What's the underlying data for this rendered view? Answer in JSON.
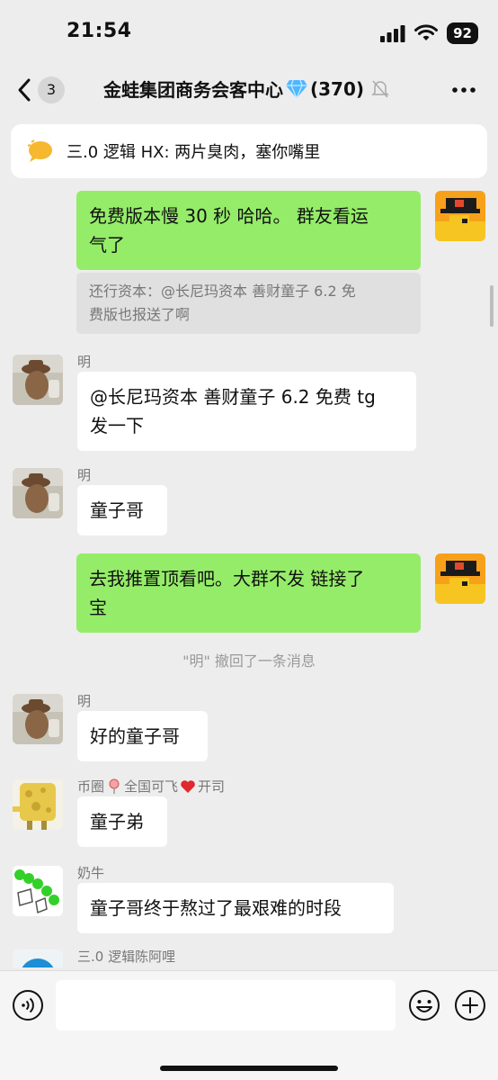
{
  "status_bar": {
    "time": "21:54",
    "battery": "92"
  },
  "nav": {
    "back_count": "3",
    "title": "金蛙集团商务会客中心",
    "member_count": "(370)",
    "title_badge_icon": "diamond-icon"
  },
  "pinned": {
    "text": "三.0 逻辑 HX: 两片臭肉，塞你嘴里"
  },
  "messages": {
    "m1": {
      "text_line1": "免费版本慢 30 秒 哈哈。 群友看运",
      "text_line2": "气了"
    },
    "m1_quote": {
      "line1": "还行资本：@长尼玛资本 善财童子 6.2 免",
      "line2": "费版也报送了啊"
    },
    "m2": {
      "sender": "明",
      "line1": "@长尼玛资本 善财童子 6.2 免费 tg",
      "line2": "发一下"
    },
    "m3": {
      "sender": "明",
      "text": "童子哥"
    },
    "m4": {
      "line1": "去我推置顶看吧。大群不发 链接了",
      "line2": "宝"
    },
    "recall_note": "\"明\" 撤回了一条消息",
    "m5": {
      "sender": "明",
      "text": "好的童子哥"
    },
    "m6": {
      "sender_prefix": "币圈",
      "sender_mid": "全国可飞",
      "sender_suffix": "开司",
      "text": "童子弟"
    },
    "m7": {
      "sender": "奶牛",
      "text": "童子哥终于熬过了最艰难的时段"
    },
    "m8": {
      "sender": "三.0 逻辑陈阿哩"
    }
  },
  "input": {
    "placeholder": ""
  },
  "colors": {
    "background": "#ededed",
    "bubble_green": "#95ec69",
    "bubble_white": "#ffffff",
    "muted_text": "#777777"
  }
}
